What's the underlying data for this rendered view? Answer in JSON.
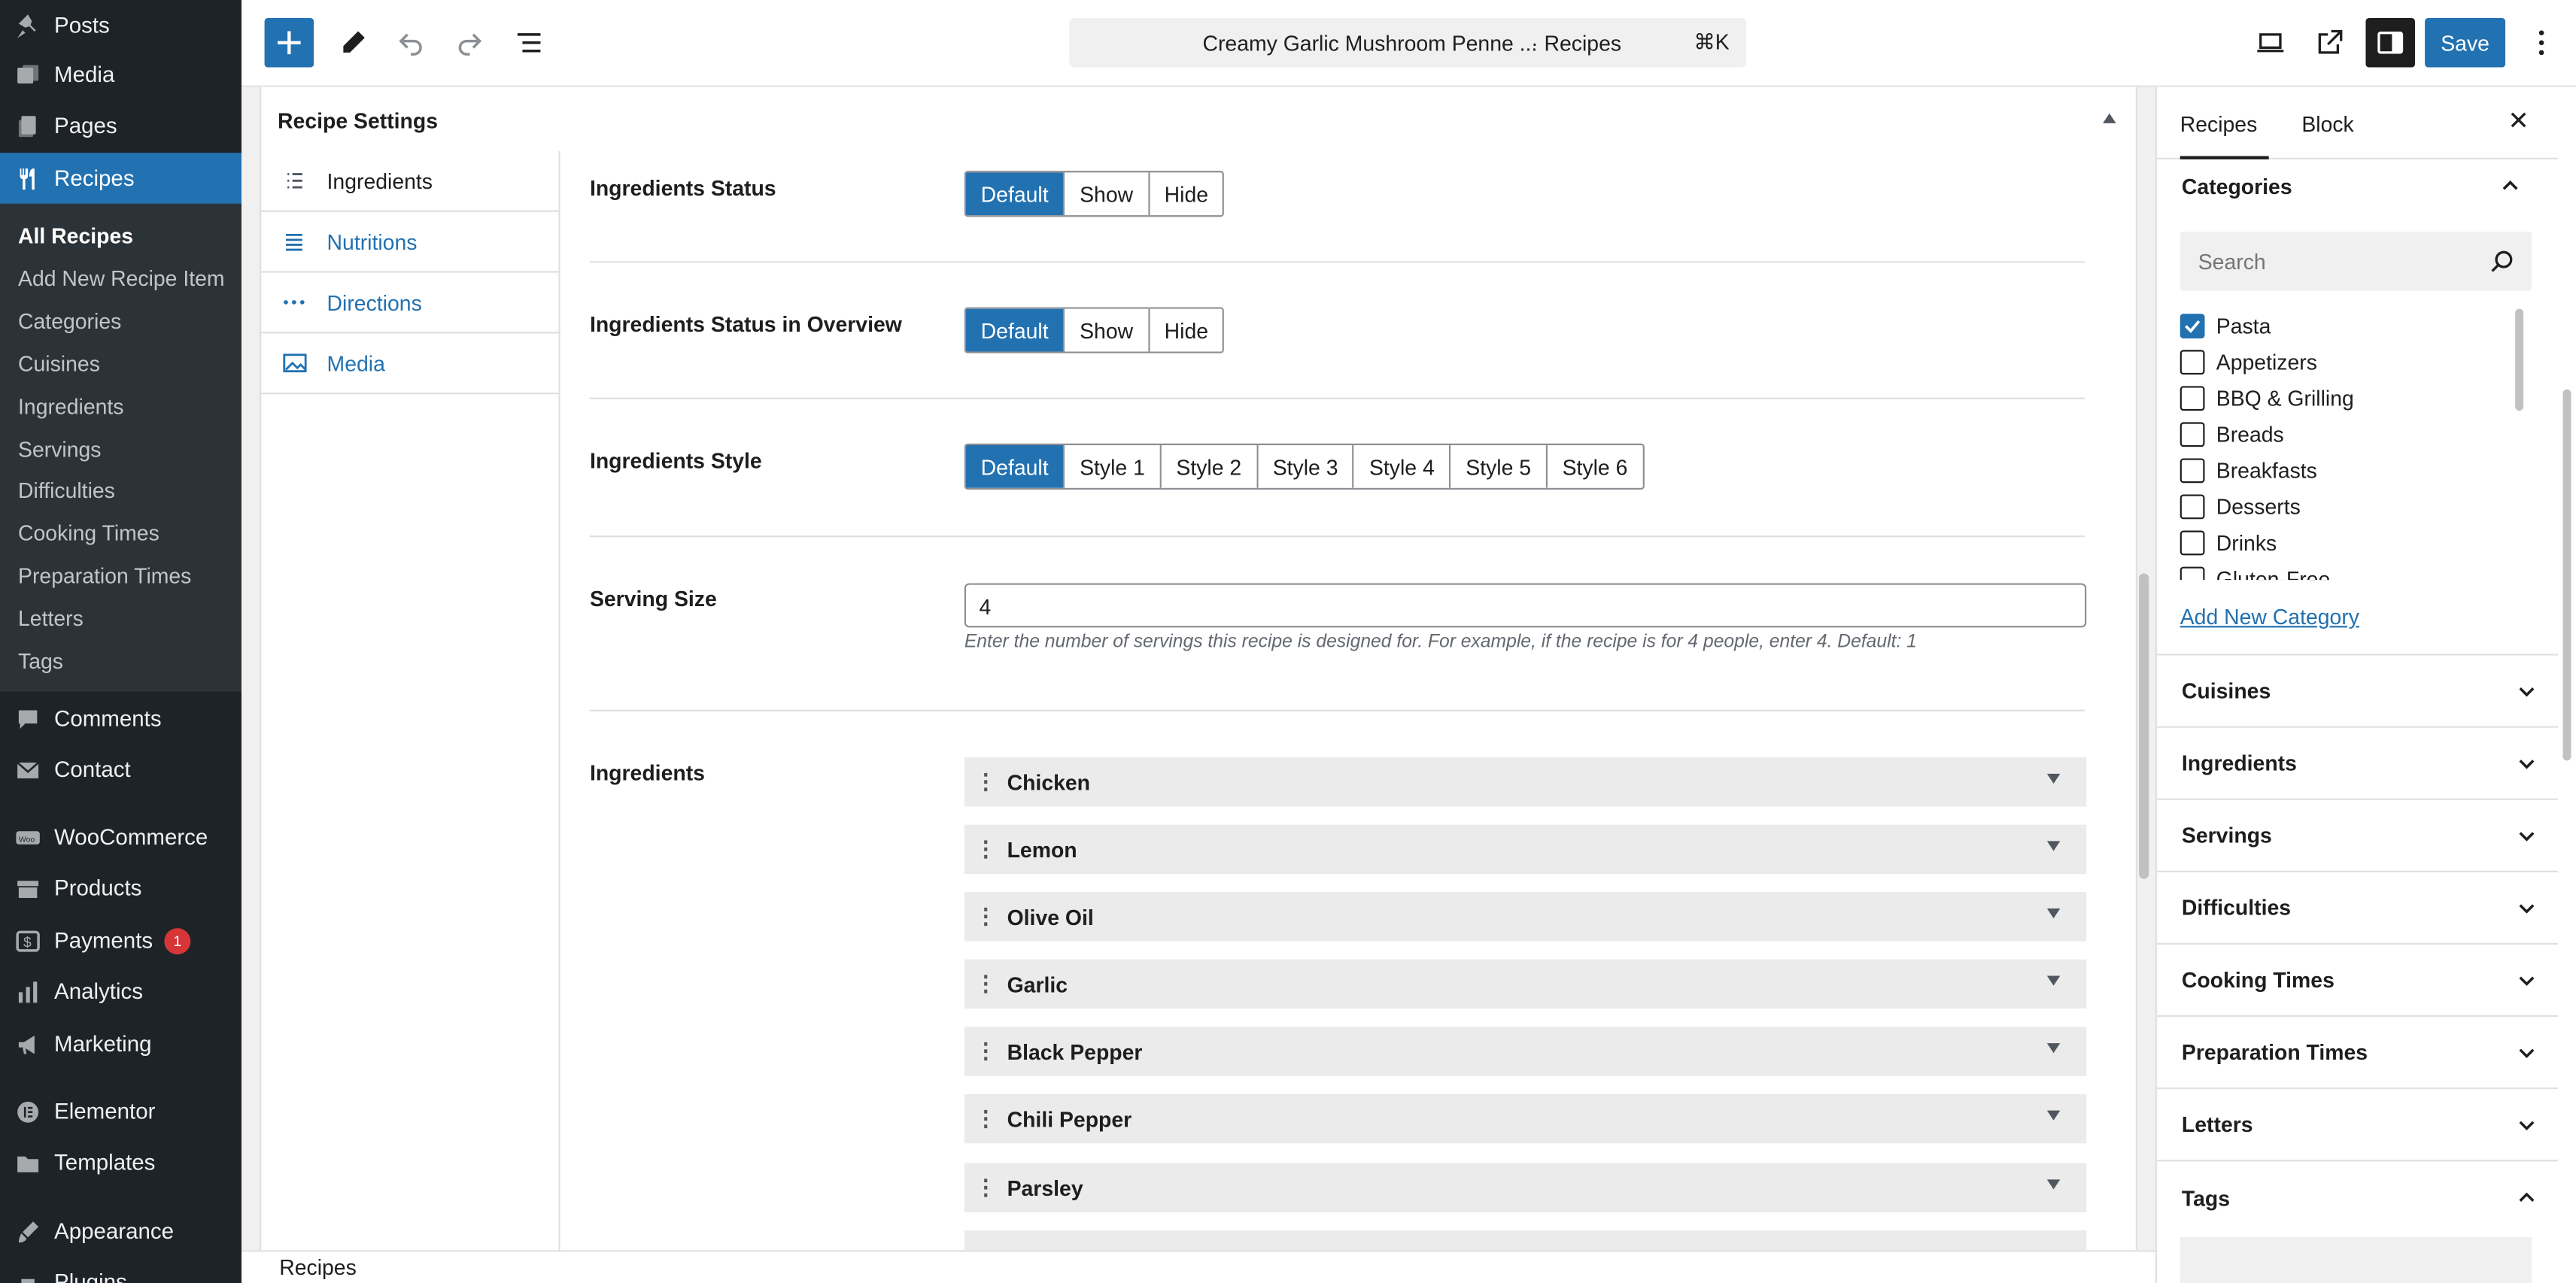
{
  "admin_menu": {
    "posts": "Posts",
    "media": "Media",
    "pages": "Pages",
    "recipes": "Recipes",
    "submenu": [
      "All Recipes",
      "Add New Recipe Item",
      "Categories",
      "Cuisines",
      "Ingredients",
      "Servings",
      "Difficulties",
      "Cooking Times",
      "Preparation Times",
      "Letters",
      "Tags"
    ],
    "comments": "Comments",
    "contact": "Contact",
    "woocommerce": "WooCommerce",
    "products": "Products",
    "payments": "Payments",
    "payments_badge": "1",
    "analytics": "Analytics",
    "marketing": "Marketing",
    "elementor": "Elementor",
    "templates": "Templates",
    "appearance": "Appearance",
    "plugins": "Plugins"
  },
  "toolbar": {
    "doc_title": "Creamy Garlic Mushroom Penne ...",
    "doc_type": "· Recipes",
    "shortcut": "⌘K",
    "save_label": "Save"
  },
  "panel": {
    "title": "Recipe Settings",
    "tabs": [
      "Ingredients",
      "Nutritions",
      "Directions",
      "Media"
    ],
    "ingredients_status_label": "Ingredients Status",
    "ingredients_status_options": [
      "Default",
      "Show",
      "Hide"
    ],
    "ingredients_overview_label": "Ingredients Status in Overview",
    "ingredients_overview_options": [
      "Default",
      "Show",
      "Hide"
    ],
    "ingredients_style_label": "Ingredients Style",
    "ingredients_style_options": [
      "Default",
      "Style 1",
      "Style 2",
      "Style 3",
      "Style 4",
      "Style 5",
      "Style 6"
    ],
    "selected_option": "Default",
    "serving_size_label": "Serving Size",
    "serving_size_value": "4",
    "serving_size_help": "Enter the number of servings this recipe is designed for. For example, if the recipe is for 4 people, enter 4. Default: 1",
    "ingredients_label": "Ingredients",
    "ingredient_items": [
      "Chicken",
      "Lemon",
      "Olive Oil",
      "Garlic",
      "Black Pepper",
      "Chili Pepper",
      "Parsley"
    ]
  },
  "sidebar": {
    "tab_recipes": "Recipes",
    "tab_block": "Block",
    "categories_title": "Categories",
    "search_placeholder": "Search",
    "categories": [
      "Pasta",
      "Appetizers",
      "BBQ & Grilling",
      "Breads",
      "Breakfasts",
      "Desserts",
      "Drinks",
      "Gluten-Free"
    ],
    "checked_category": "Pasta",
    "add_new_category": "Add New Category",
    "sections": [
      "Cuisines",
      "Ingredients",
      "Servings",
      "Difficulties",
      "Cooking Times",
      "Preparation Times",
      "Letters"
    ],
    "tags_title": "Tags"
  },
  "footer": {
    "breadcrumb": "Recipes"
  },
  "colors": {
    "accent": "#2271b1",
    "admin_bg": "#1d2327",
    "badge": "#d63638"
  }
}
